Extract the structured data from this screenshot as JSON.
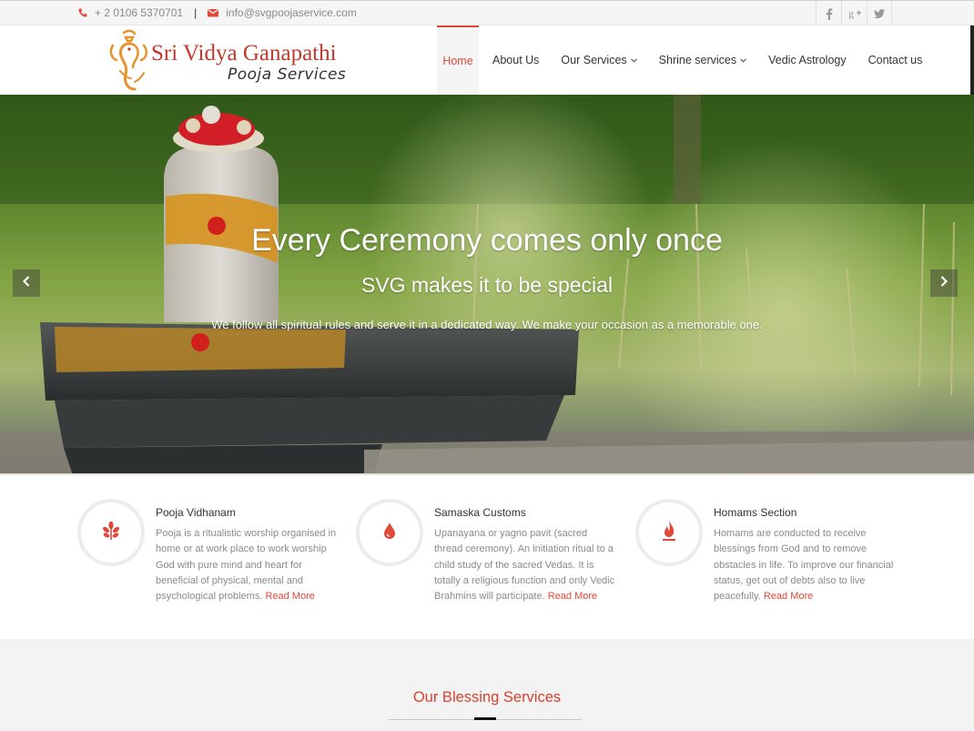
{
  "topbar": {
    "phone": "+ 2 0106 5370701",
    "separator": "|",
    "email": "info@svgpoojaservice.com",
    "social": [
      "facebook-icon",
      "google-plus-icon",
      "twitter-icon"
    ]
  },
  "logo": {
    "line1": "Sri Vidya Ganapathi",
    "line2": "Pooja Services"
  },
  "nav": {
    "items": [
      {
        "label": "Home",
        "active": true
      },
      {
        "label": "About Us"
      },
      {
        "label": "Our Services",
        "dropdown": true
      },
      {
        "label": "Shrine services",
        "dropdown": true
      },
      {
        "label": "Vedic Astrology"
      },
      {
        "label": "Contact us"
      }
    ]
  },
  "hero": {
    "heading": "Every Ceremony comes only once",
    "subheading": "SVG makes it to be special",
    "text": "We follow all spiritual rules and serve it in a dedicated way. We make your occasion as a memorable one."
  },
  "features": [
    {
      "icon": "flower-icon",
      "title": "Pooja Vidhanam",
      "text": "Pooja is a ritualistic worship organised in home or at work place to work worship God with pure mind and heart for beneficial of physical, mental and psychological problems.",
      "link": "Read More"
    },
    {
      "icon": "drop-icon",
      "title": "Samaska Customs",
      "text": "Upanayana or yagno pavit (sacred thread ceremony). An initiation ritual to a child study of the sacred Vedas. It is totally a religious function and only Vedic Brahmins will participate.",
      "link": "Read More"
    },
    {
      "icon": "flame-icon",
      "title": "Homams Section",
      "text": "Homams are conducted to receive blessings from God and to remove obstacles in life. To improve our financial status, get out of debts also to live peacefully.",
      "link": "Read More"
    }
  ],
  "blessing": {
    "title": "Our Blessing Services"
  },
  "colors": {
    "accent": "#e0493a",
    "text": "#333333",
    "muted": "#8a8a8a"
  }
}
